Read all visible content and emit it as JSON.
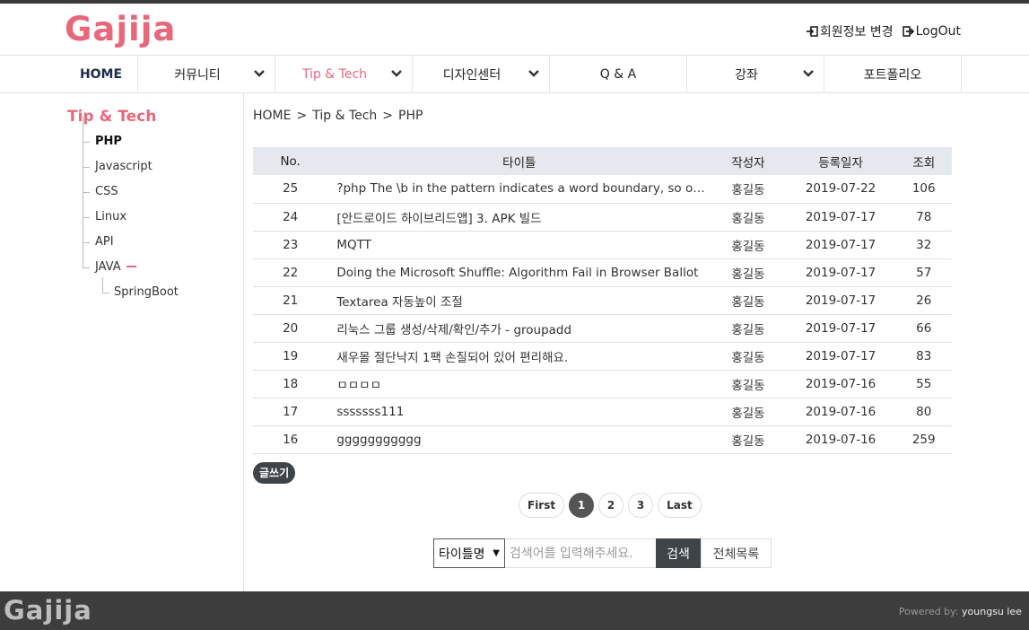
{
  "header": {
    "logo": "Gajija",
    "edit_profile": "회원정보 변경",
    "logout": "LogOut"
  },
  "nav": {
    "items": [
      {
        "label": "HOME"
      },
      {
        "label": "커뮤니티"
      },
      {
        "label": "Tip & Tech"
      },
      {
        "label": "디자인센터"
      },
      {
        "label": "Q & A"
      },
      {
        "label": "강좌"
      },
      {
        "label": "포트폴리오"
      }
    ]
  },
  "sidebar": {
    "title": "Tip & Tech",
    "items": [
      {
        "label": "PHP"
      },
      {
        "label": "Javascript"
      },
      {
        "label": "CSS"
      },
      {
        "label": "Linux"
      },
      {
        "label": "API"
      },
      {
        "label": "JAVA"
      }
    ],
    "sub_item": "SpringBoot"
  },
  "breadcrumb": {
    "home": "HOME",
    "sep": ">",
    "section": "Tip & Tech",
    "page": "PHP"
  },
  "table": {
    "headers": {
      "no": "No.",
      "title": "타이틀",
      "author": "작성자",
      "date": "등록일자",
      "views": "조회"
    },
    "rows": [
      {
        "no": "25",
        "title": "?php The \\b in the pattern indicates a word boundary, so only ...",
        "author": "홍길동",
        "date": "2019-07-22",
        "views": "106"
      },
      {
        "no": "24",
        "title": "[안드로이드 하이브리드앱] 3. APK 빌드",
        "author": "홍길동",
        "date": "2019-07-17",
        "views": "78"
      },
      {
        "no": "23",
        "title": "MQTT",
        "author": "홍길동",
        "date": "2019-07-17",
        "views": "32"
      },
      {
        "no": "22",
        "title": "Doing the Microsoft Shuffle: Algorithm Fail in Browser Ballot",
        "author": "홍길동",
        "date": "2019-07-17",
        "views": "57"
      },
      {
        "no": "21",
        "title": "Textarea 자동높이 조절",
        "author": "홍길동",
        "date": "2019-07-17",
        "views": "26"
      },
      {
        "no": "20",
        "title": "리눅스 그룹 생성/삭제/확인/추가 - groupadd",
        "author": "홍길동",
        "date": "2019-07-17",
        "views": "66"
      },
      {
        "no": "19",
        "title": "새우몰 절단낙지 1팩 손질되어 있어 편리해요.",
        "author": "홍길동",
        "date": "2019-07-17",
        "views": "83"
      },
      {
        "no": "18",
        "title": "ㅁㅁㅁㅁ",
        "author": "홍길동",
        "date": "2019-07-16",
        "views": "55"
      },
      {
        "no": "17",
        "title": "sssssss111",
        "author": "홍길동",
        "date": "2019-07-16",
        "views": "80"
      },
      {
        "no": "16",
        "title": "ggggggggggg",
        "author": "홍길동",
        "date": "2019-07-16",
        "views": "259"
      }
    ]
  },
  "write_button": "글쓰기",
  "pagination": {
    "first": "First",
    "pages": [
      "1",
      "2",
      "3"
    ],
    "current": "1",
    "last": "Last"
  },
  "search": {
    "select_value": "타이틀명",
    "placeholder": "검색어를 입력해주세요.",
    "button": "검색",
    "all_button": "전체목록"
  },
  "footer": {
    "logo": "Gajija",
    "powered_label": "Powered by:",
    "powered_name": "youngsu lee"
  },
  "colors": {
    "accent": "#e9677b",
    "dark": "#3d3d3d",
    "table_header": "#e5e8ee"
  }
}
